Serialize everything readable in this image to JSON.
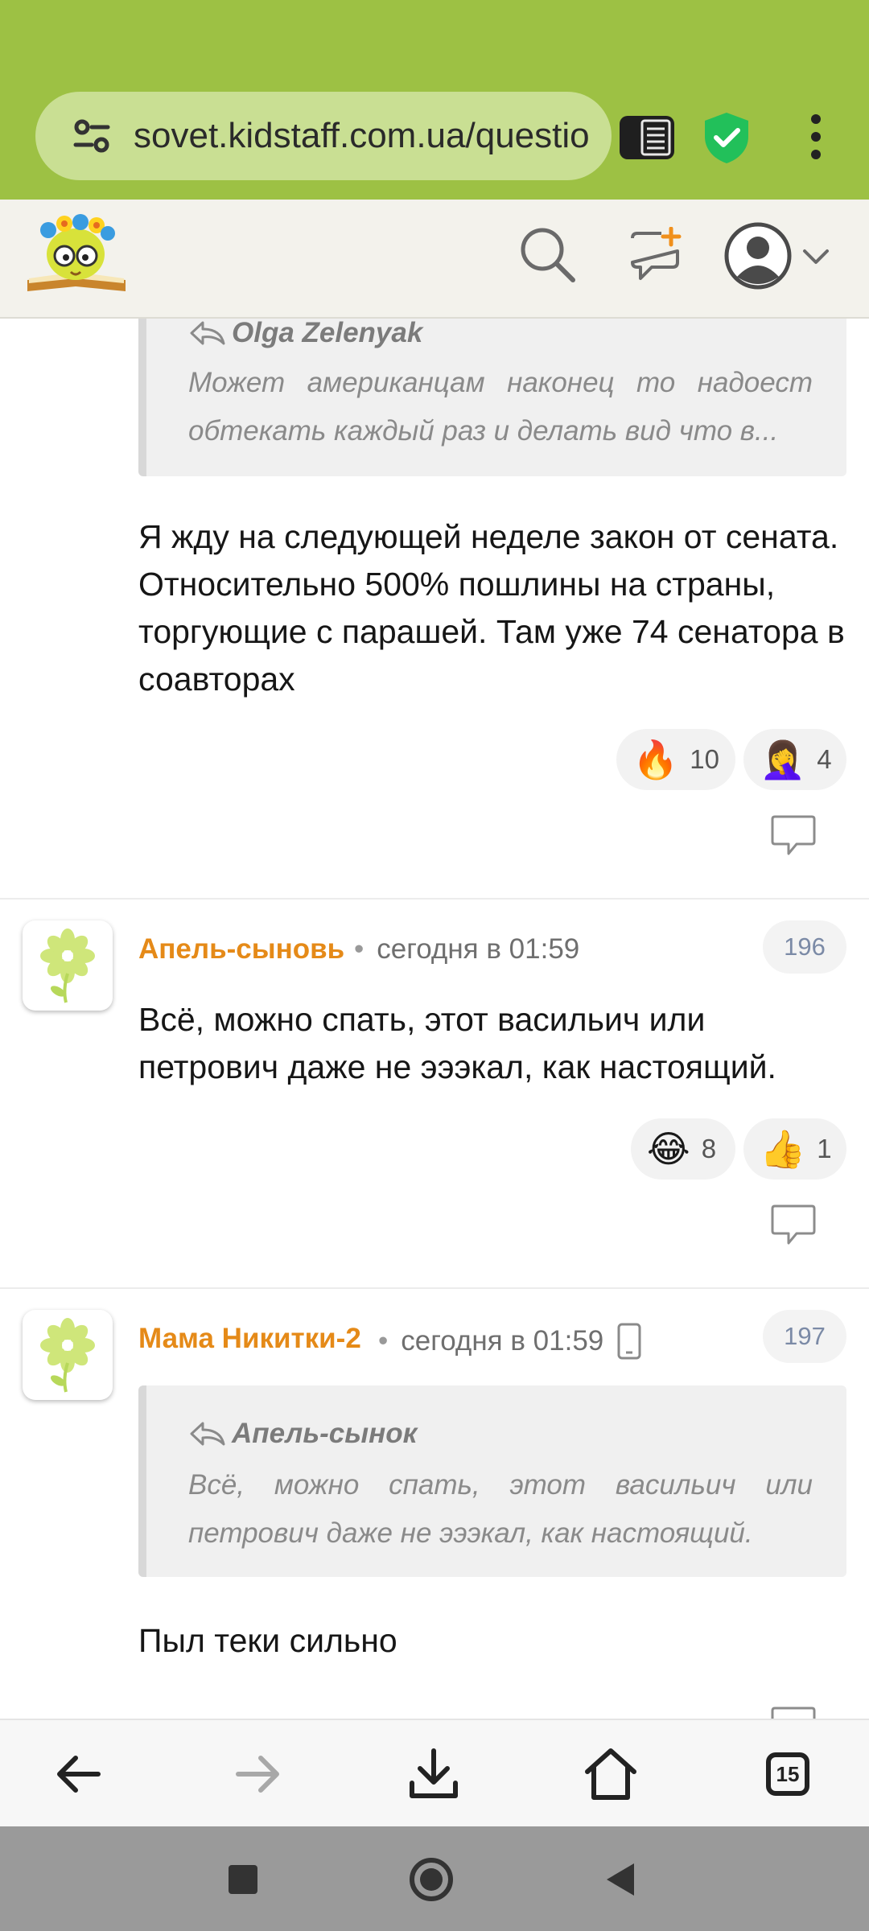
{
  "browser": {
    "url": "sovet.kidstaff.com.ua/questio",
    "tab_count": "15",
    "colors": {
      "toolbar": "#9dc144",
      "url_bar": "#c9df93",
      "shield": "#22c05a"
    }
  },
  "site_header": {
    "icons": [
      "logo",
      "search-icon",
      "new-topic-icon",
      "user-avatar-icon",
      "chevron-down-icon"
    ]
  },
  "comments": [
    {
      "quote": {
        "author": "Olga Zelenyak",
        "text": "Может американцам наконец то надоест обтекать каждый раз и делать вид что в..."
      },
      "text": "Я жду на следующей неделе закон от сената. Относительно 500% пошлины на страны, торгующие с парашей. Там уже 74 сенатора в соавторах",
      "reactions": [
        {
          "emoji": "🔥",
          "count": "10"
        },
        {
          "emoji": "🤦‍♀️",
          "count": "4"
        }
      ]
    },
    {
      "author": "Апель-сыновь",
      "time": "сегодня в 01:59",
      "number": "196",
      "text": "Всё, можно спать, этот васильич или петрович даже не эээкал, как настоящий.",
      "reactions": [
        {
          "emoji": "😂",
          "count": "8"
        },
        {
          "emoji": "👍",
          "count": "1"
        }
      ]
    },
    {
      "author": "Мама Никитки-2",
      "time": "сегодня в 01:59",
      "number": "197",
      "device_icon": "mobile-phone-icon",
      "quote": {
        "author": "Апель-сынок",
        "text": "Всё, можно спать, этот васильич или петрович даже не эээкал, как настоящий."
      },
      "text": "Пыл теки сильно"
    }
  ],
  "colors": {
    "author_name": "#e58a18",
    "post_number": "#7b8aa6"
  }
}
